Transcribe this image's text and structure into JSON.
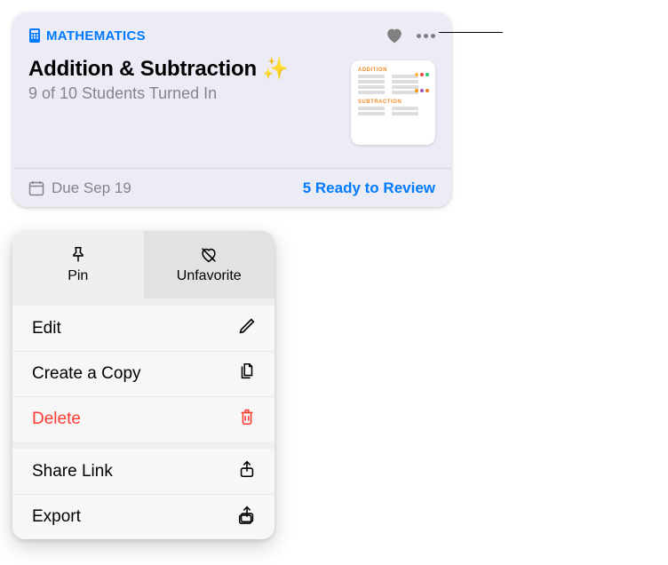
{
  "card": {
    "subject": "MATHEMATICS",
    "title": "Addition & Subtraction ✨",
    "subtitle": "9 of 10 Students Turned In",
    "due_label": "Due Sep 19",
    "review_label": "5 Ready to Review"
  },
  "thumbnail": {
    "heading1": "ADDITION",
    "heading2": "SUBTRACTION"
  },
  "menu": {
    "top": {
      "pin_label": "Pin",
      "unfavorite_label": "Unfavorite"
    },
    "rows": {
      "edit": "Edit",
      "copy": "Create a Copy",
      "delete": "Delete",
      "share": "Share Link",
      "export": "Export"
    }
  }
}
